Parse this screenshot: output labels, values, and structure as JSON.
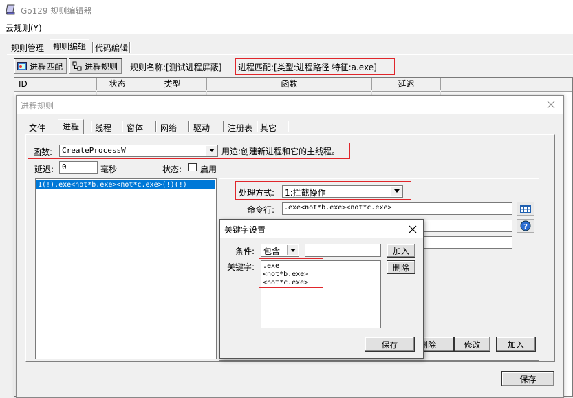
{
  "app": {
    "title": "Go129 规则编辑器",
    "menu": [
      "云规则(Y)"
    ]
  },
  "main_tabs": [
    {
      "label": "规则管理"
    },
    {
      "label": "规则编辑"
    },
    {
      "label": "代码编辑"
    }
  ],
  "toolbar": {
    "match_button": "进程匹配",
    "rule_button": "进程规则",
    "rule_name": "规则名称:[测试进程屏蔽]",
    "process_match": "进程匹配:[类型:进程路径  特征:a.exe]"
  },
  "table": {
    "columns": [
      "ID",
      "状态",
      "类型",
      "函数",
      "延迟"
    ]
  },
  "dialog": {
    "title": "进程规则",
    "tabs": [
      "文件",
      "进程",
      "线程",
      "窗体",
      "网络",
      "驱动",
      "注册表",
      "其它"
    ],
    "function_label": "函数:",
    "function_value": "CreateProcessW",
    "purpose": "用途:创建新进程和它的主线程。",
    "delay_label": "延迟:",
    "delay_value": "0",
    "delay_unit": "毫秒",
    "state_label": "状态:",
    "enable_label": "启用",
    "rule_list": [
      "1(!).exe<not*b.exe><not*c.exe>(!)(!)"
    ],
    "handling_label": "处理方式:",
    "handling_value": "1:拦截操作",
    "cmdline_label": "命令行:",
    "cmdline_value": ".exe<not*b.exe><not*c.exe>",
    "buttons": {
      "delete": "删除",
      "modify": "修改",
      "add": "加入"
    },
    "save": "保存"
  },
  "keyword_dialog": {
    "title": "关键字设置",
    "condition_label": "条件:",
    "condition_value": "包含",
    "condition_input": "",
    "add": "加入",
    "keyword_label": "关键字:",
    "delete": "删除",
    "keywords": [
      ".exe",
      "<not*b.exe>",
      "<not*c.exe>"
    ],
    "save": "保存"
  }
}
